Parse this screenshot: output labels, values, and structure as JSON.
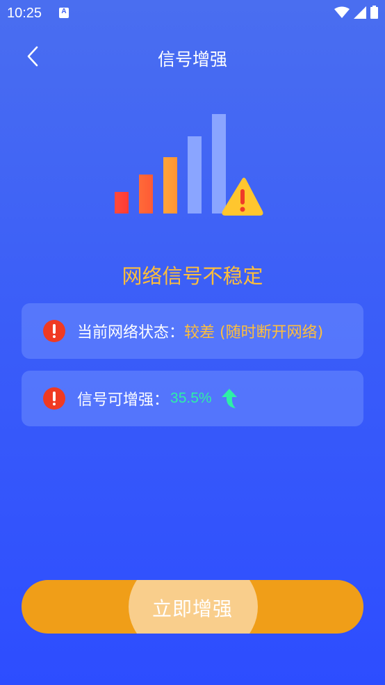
{
  "status_bar": {
    "time": "10:25",
    "notif_letter": "A"
  },
  "nav": {
    "title": "信号增强"
  },
  "headline": "网络信号不稳定",
  "cards": [
    {
      "label": "当前网络状态：",
      "value": "较差 (随时断开网络)"
    },
    {
      "label": "信号可增强：",
      "value": "35.5%"
    }
  ],
  "button": {
    "label": "立即增强"
  },
  "colors": {
    "accent_orange": "#f09e18",
    "warning_yellow": "#ffbe3b",
    "success_green": "#2df0a6",
    "alert_red": "#f03a22"
  },
  "icons": [
    "back-chevron-icon",
    "signal-bars-icon",
    "warning-triangle-icon",
    "alert-circle-icon",
    "arrow-up-icon",
    "wifi-icon",
    "cellular-icon",
    "battery-icon"
  ]
}
